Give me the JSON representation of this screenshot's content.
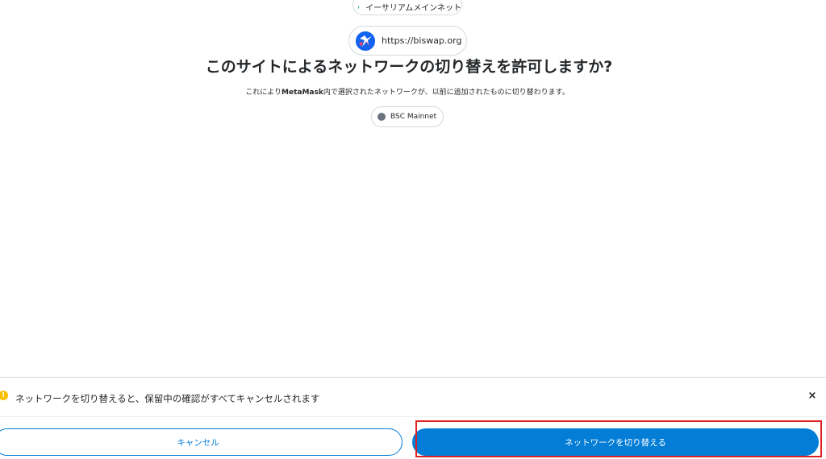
{
  "network": {
    "label": "イーサリアムメインネット",
    "dot_color": "#29b6af"
  },
  "origin": {
    "url": "https://biswap.org",
    "icon": "biswap-bird-icon",
    "icon_color": "#1263f1"
  },
  "dialog": {
    "title": "このサイトによるネットワークの切り替えを許可しますか?",
    "subtitle_prefix": "これにより",
    "subtitle_bold": "MetaMask",
    "subtitle_suffix": "内で選択されたネットワークが、以前に追加されたものに切り替わります。"
  },
  "target_network": {
    "label": "BSC Mainnet",
    "dot_color": "#6a737d"
  },
  "footer": {
    "warning_icon": "warning-icon",
    "warning_text": "ネットワークを切り替えると、保留中の確認がすべてキャンセルされます",
    "close_icon": "close-icon",
    "close_glyph": "×",
    "warning_glyph": "!",
    "cancel_label": "キャンセル",
    "switch_label": "ネットワークを切り替える",
    "accent_color": "#037dd6",
    "highlight_color": "#e02020"
  }
}
